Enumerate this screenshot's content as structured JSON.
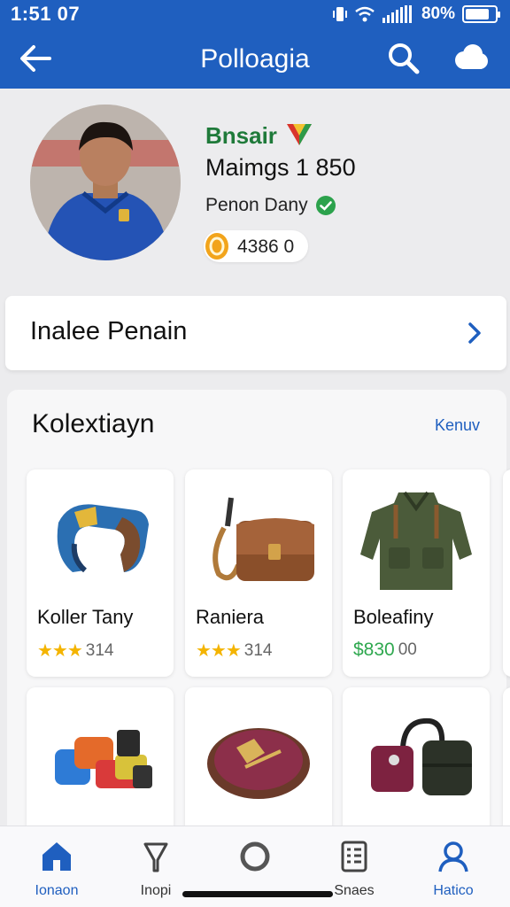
{
  "status": {
    "time": "1:51 07",
    "battery": "80%",
    "battery_level": 0.8
  },
  "header": {
    "title": "Polloagia"
  },
  "profile": {
    "name": "Bnsair",
    "subtitle": "Maimgs 1 850",
    "role": "Penon Dany",
    "coins": "4386 0"
  },
  "panel": {
    "label": "Inalee Penain"
  },
  "collection": {
    "title": "Kolextiayn",
    "link": "Kenuv",
    "items": [
      {
        "name": "Koller Tany",
        "stars": "★★★",
        "meta": "314"
      },
      {
        "name": "Raniera",
        "stars": "★★★",
        "meta": "314"
      },
      {
        "name": "Boleafiny",
        "price": "$830",
        "meta": "00"
      },
      {
        "name": "",
        "meta": ""
      },
      {
        "name": "",
        "meta": ""
      },
      {
        "name": "",
        "meta": ""
      }
    ]
  },
  "bottom_nav": [
    {
      "label": "Ionaon",
      "icon": "home-icon"
    },
    {
      "label": "Inopi",
      "icon": "lightbulb-icon"
    },
    {
      "label": "",
      "icon": "circle-icon"
    },
    {
      "label": "Snaes",
      "icon": "document-icon"
    },
    {
      "label": "Hatico",
      "icon": "user-icon"
    }
  ],
  "colors": {
    "primary": "#1f5fbf",
    "green": "#1f7a3a",
    "star": "#f4b400"
  }
}
